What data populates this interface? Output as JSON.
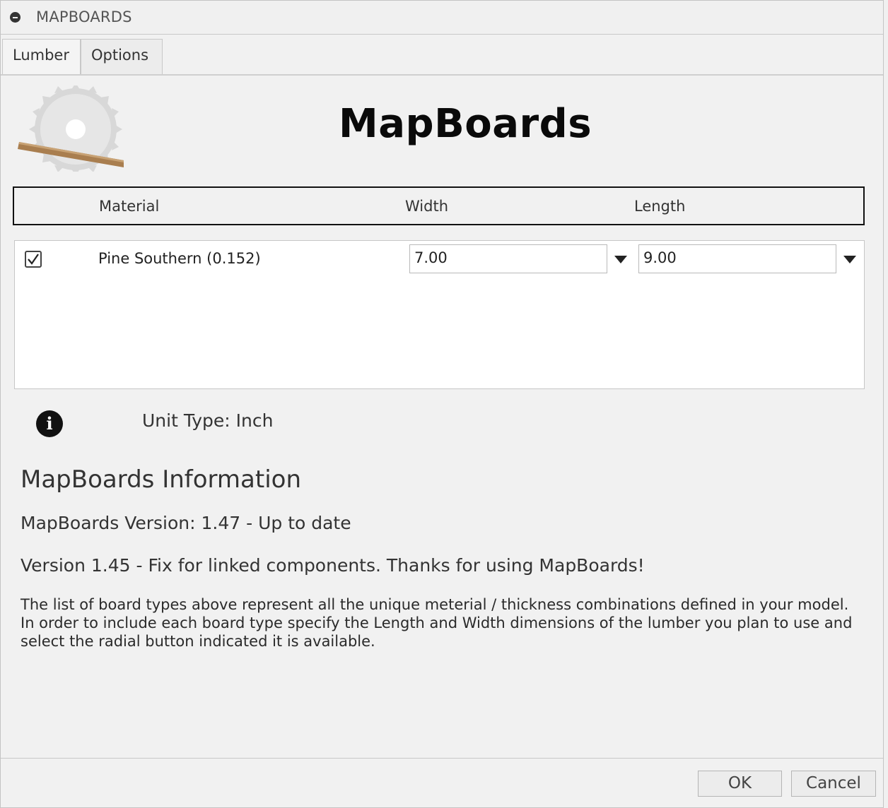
{
  "window": {
    "title": "MAPBOARDS"
  },
  "tabs": [
    {
      "label": "Lumber",
      "active": true
    },
    {
      "label": "Options",
      "active": false
    }
  ],
  "header": {
    "app_title": "MapBoards",
    "logo_icon": "saw-blade-icon"
  },
  "table": {
    "columns": [
      "Material",
      "Width",
      "Length"
    ],
    "rows": [
      {
        "checked": true,
        "material": "Pine Southern (0.152)",
        "width": "7.00",
        "length": "9.00"
      }
    ]
  },
  "unit": {
    "icon": "info-icon",
    "text": "Unit Type: Inch"
  },
  "info": {
    "heading": "MapBoards Information",
    "version": "MapBoards Version: 1.47 - Up to date",
    "changelog": "Version 1.45 - Fix for linked components. Thanks for using MapBoards!",
    "description": "The list of board types above represent all the unique meterial / thickness combinations defined in your model. In order to include each board type specify the Length and Width dimensions of the lumber you plan to use and select the radial button indicated it is available."
  },
  "buttons": {
    "ok": "OK",
    "cancel": "Cancel"
  }
}
